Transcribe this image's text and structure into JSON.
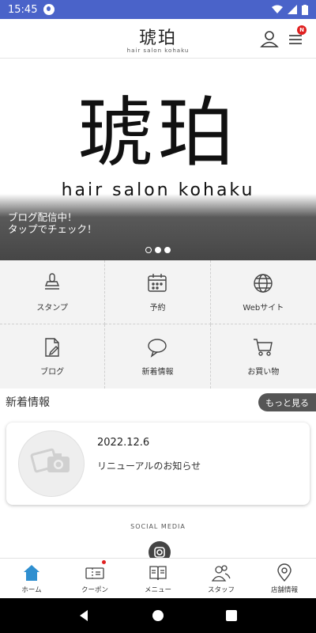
{
  "status_bar": {
    "time": "15:45"
  },
  "header": {
    "logo_kanji": "琥珀",
    "logo_sub": "hair salon kohaku",
    "notify_badge": "N"
  },
  "hero": {
    "logo_kanji": "琥珀",
    "logo_sub": "hair salon kohaku",
    "caption": "ブログ配信中！\nタップでチェック！",
    "slides": 3,
    "active_slide": 2
  },
  "menu": {
    "items": [
      {
        "label": "スタンプ",
        "icon": "stamp-icon"
      },
      {
        "label": "予約",
        "icon": "calendar-icon"
      },
      {
        "label": "Webサイト",
        "icon": "globe-icon"
      },
      {
        "label": "ブログ",
        "icon": "blog-icon"
      },
      {
        "label": "新着情報",
        "icon": "speech-bubble-icon"
      },
      {
        "label": "お買い物",
        "icon": "cart-icon"
      }
    ]
  },
  "news": {
    "section_title": "新着情報",
    "more_label": "もっと見る",
    "items": [
      {
        "date": "2022.12.6",
        "title": "リニューアルのお知らせ"
      }
    ]
  },
  "social": {
    "label": "SOCIAL MEDIA"
  },
  "tabbar": {
    "tabs": [
      {
        "label": "ホーム",
        "icon": "home-icon",
        "active": true
      },
      {
        "label": "クーポン",
        "icon": "coupon-icon"
      },
      {
        "label": "メニュー",
        "icon": "menu-book-icon"
      },
      {
        "label": "スタッフ",
        "icon": "staff-icon"
      },
      {
        "label": "店舗情報",
        "icon": "location-icon"
      }
    ]
  },
  "colors": {
    "status_bar": "#4a63c9",
    "accent": "#2f8fd0",
    "badge": "#e02020",
    "more_button": "#555555"
  }
}
